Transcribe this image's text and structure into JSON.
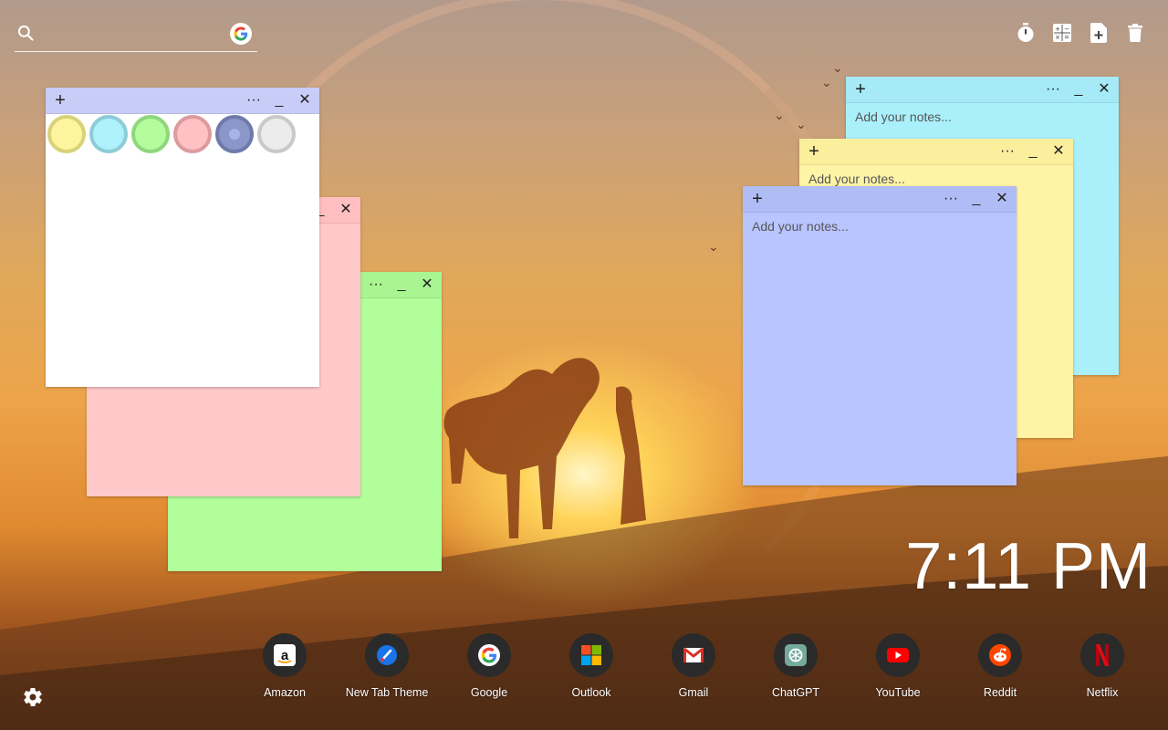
{
  "search": {
    "placeholder": "",
    "value": ""
  },
  "toolbar": {
    "buttons": [
      {
        "icon": "timer-icon"
      },
      {
        "icon": "calculator-icon"
      },
      {
        "icon": "add-note-icon"
      },
      {
        "icon": "trash-icon"
      }
    ]
  },
  "notes": {
    "placeholder": "Add your notes...",
    "controls": {
      "add": "+",
      "more": "···",
      "minimize": "_",
      "close": "✕"
    },
    "palette": [
      "#fff49e",
      "#aef0fb",
      "#b3fb9c",
      "#ffc1c3",
      "#8a97c8",
      "#ececec"
    ]
  },
  "clock": {
    "time": "7:11 PM"
  },
  "shortcuts": [
    {
      "label": "Amazon",
      "icon": "amazon-icon"
    },
    {
      "label": "New Tab Theme",
      "icon": "new-tab-theme-icon"
    },
    {
      "label": "Google",
      "icon": "google-icon"
    },
    {
      "label": "Outlook",
      "icon": "outlook-icon"
    },
    {
      "label": "Gmail",
      "icon": "gmail-icon"
    },
    {
      "label": "ChatGPT",
      "icon": "chatgpt-icon"
    },
    {
      "label": "YouTube",
      "icon": "youtube-icon"
    },
    {
      "label": "Reddit",
      "icon": "reddit-icon"
    },
    {
      "label": "Netflix",
      "icon": "netflix-icon"
    }
  ]
}
